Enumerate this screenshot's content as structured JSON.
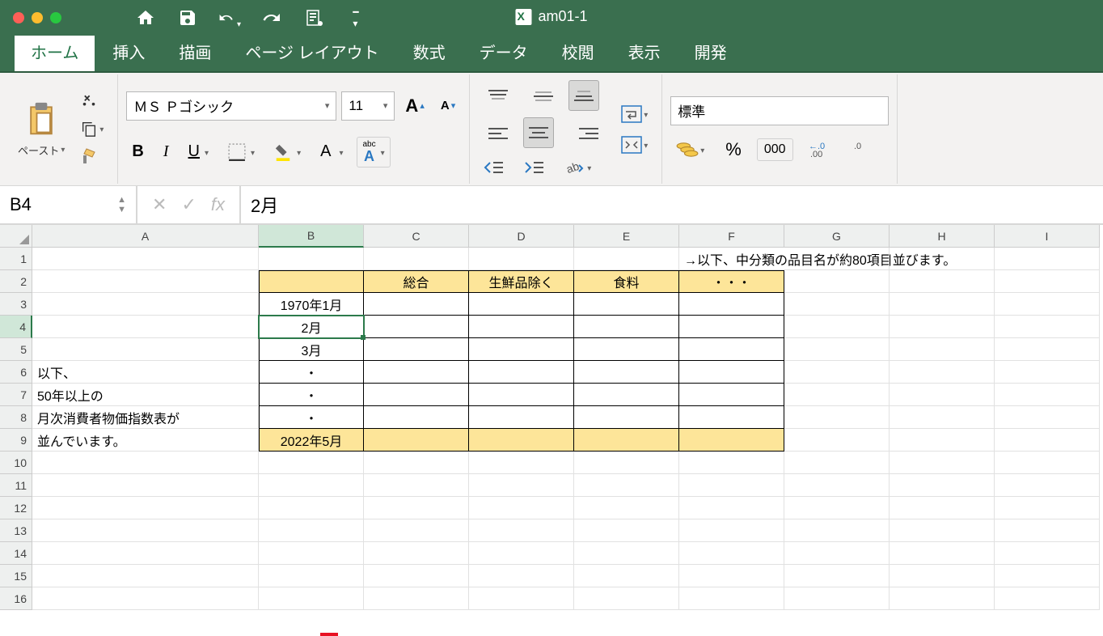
{
  "document": {
    "title": "am01-1"
  },
  "tabs": [
    "ホーム",
    "挿入",
    "描画",
    "ページ レイアウト",
    "数式",
    "データ",
    "校閲",
    "表示",
    "開発"
  ],
  "tabs_active": 0,
  "ribbon": {
    "paste_label": "ペースト",
    "font_name": "ＭＳ Ｐゴシック",
    "font_size": "11",
    "number_format": "標準"
  },
  "namebox": "B4",
  "formula": "2月",
  "columns": [
    "A",
    "B",
    "C",
    "D",
    "E",
    "F",
    "G",
    "H",
    "I"
  ],
  "rows": [
    "1",
    "2",
    "3",
    "4",
    "5",
    "6",
    "7",
    "8",
    "9",
    "10",
    "11",
    "12",
    "13",
    "14",
    "15",
    "16"
  ],
  "cells": {
    "F1_overflow": "→以下、中分類の品目名が約80項目並びます。",
    "C2": "総合",
    "D2": "生鮮品除く",
    "E2": "食料",
    "F2": "・・・",
    "B3": "1970年1月",
    "B4": "2月",
    "B5": "3月",
    "A6": "以下、",
    "B6": "・",
    "A7": "50年以上の",
    "B7": "・",
    "A8": "月次消費者物価指数表が",
    "B8": "・",
    "A9": "並んでいます。",
    "B9": "2022年5月"
  }
}
